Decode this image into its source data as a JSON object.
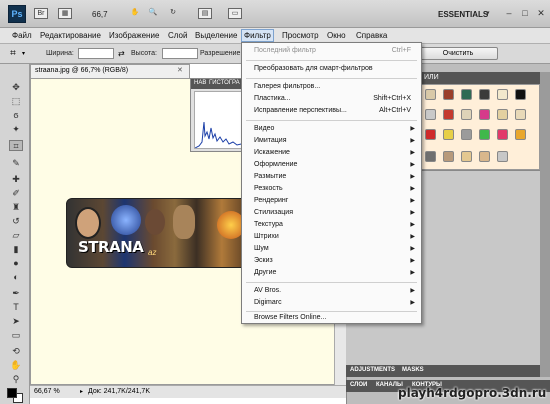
{
  "app": {
    "logo": "Ps",
    "zoom": "66,7",
    "workspace": "ESSENTIALS"
  },
  "menu": [
    "Файл",
    "Редактирование",
    "Изображение",
    "Слой",
    "Выделение",
    "Фильтр",
    "Просмотр",
    "Окно",
    "Справка"
  ],
  "options": {
    "width_label": "Ширина:",
    "height_label": "Высота:",
    "resolution_label": "Разрешение:",
    "clear_button": "Очистить"
  },
  "document": {
    "tab_title": "straana.jpg @ 66,7% (RGB/8)",
    "status_zoom": "66,67 %",
    "status_doc": "Док: 241,7K/241,7K",
    "banner_text": "STRANA",
    "banner_sub": "az"
  },
  "nav_panel": {
    "tabs": [
      "НАВ",
      "ГИСТОГРА"
    ]
  },
  "right_panels": {
    "styles_tab_fragment": "ИЛИ",
    "adjustments_tab": "ADJUSTMENTS",
    "masks_tab": "MASKS",
    "layers_tabs": [
      "СЛОИ",
      "КАНАЛЫ",
      "КОНТУРЫ"
    ]
  },
  "filter_menu": {
    "items": [
      {
        "label": "Последний фильтр",
        "shortcut": "Ctrl+F",
        "disabled": true
      },
      {
        "label": "Преобразовать для смарт-фильтров"
      },
      {
        "label": "Галерея фильтров..."
      },
      {
        "label": "Пластика...",
        "shortcut": "Shift+Ctrl+X"
      },
      {
        "label": "Исправление перспективы...",
        "shortcut": "Alt+Ctrl+V"
      },
      {
        "label": "Видео",
        "submenu": true
      },
      {
        "label": "Имитация",
        "submenu": true
      },
      {
        "label": "Искажение",
        "submenu": true
      },
      {
        "label": "Оформление",
        "submenu": true
      },
      {
        "label": "Размытие",
        "submenu": true
      },
      {
        "label": "Резкость",
        "submenu": true
      },
      {
        "label": "Рендеринг",
        "submenu": true
      },
      {
        "label": "Стилизация",
        "submenu": true
      },
      {
        "label": "Текстура",
        "submenu": true
      },
      {
        "label": "Штрихи",
        "submenu": true
      },
      {
        "label": "Шум",
        "submenu": true
      },
      {
        "label": "Эскиз",
        "submenu": true
      },
      {
        "label": "Другие",
        "submenu": true
      },
      {
        "label": "AV Bros.",
        "submenu": true
      },
      {
        "label": "Digimarc",
        "submenu": true
      },
      {
        "label": "Browse Filters Online..."
      }
    ]
  },
  "watermark": "playh4rdgopro.3dn.ru"
}
